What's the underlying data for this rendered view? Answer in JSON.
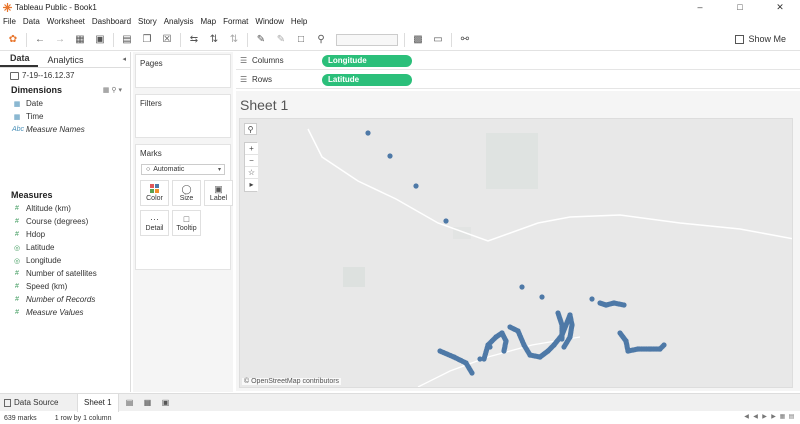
{
  "window": {
    "title": "Tableau Public - Book1",
    "controls": [
      "–",
      "□",
      "✕"
    ]
  },
  "menu": [
    "File",
    "Data",
    "Worksheet",
    "Dashboard",
    "Story",
    "Analysis",
    "Map",
    "Format",
    "Window",
    "Help"
  ],
  "toolbar": {
    "show_me_label": "Show Me"
  },
  "data_pane": {
    "tabs": [
      "Data",
      "Analytics"
    ],
    "collapse": "◂",
    "datasource": "7-19--16.12.37",
    "dimensions_header": "Dimensions",
    "dimensions": [
      {
        "label": "Date",
        "icon": "calendar-icon",
        "italic": false
      },
      {
        "label": "Time",
        "icon": "calendar-icon",
        "italic": false
      },
      {
        "label": "Measure Names",
        "icon": "abc-icon",
        "italic": true
      }
    ],
    "measures_header": "Measures",
    "measures": [
      {
        "label": "Altitude (km)",
        "icon": "measure-icon",
        "italic": false
      },
      {
        "label": "Course (degrees)",
        "icon": "measure-icon",
        "italic": false
      },
      {
        "label": "Hdop",
        "icon": "measure-icon",
        "italic": false
      },
      {
        "label": "Latitude",
        "icon": "globe-icon",
        "italic": false
      },
      {
        "label": "Longitude",
        "icon": "globe-icon",
        "italic": false
      },
      {
        "label": "Number of satellites",
        "icon": "measure-icon",
        "italic": false
      },
      {
        "label": "Speed (km)",
        "icon": "measure-icon",
        "italic": false
      },
      {
        "label": "Number of Records",
        "icon": "measure-icon",
        "italic": true
      },
      {
        "label": "Measure Values",
        "icon": "measure-icon",
        "italic": true
      }
    ]
  },
  "cards": {
    "pages": "Pages",
    "filters": "Filters",
    "marks": "Marks",
    "mark_type": "Automatic",
    "mark_buttons": [
      {
        "label": "Color",
        "icon": "color-icon"
      },
      {
        "label": "Size",
        "icon": "size-icon"
      },
      {
        "label": "Label",
        "icon": "label-icon"
      },
      {
        "label": "Detail",
        "icon": "detail-icon"
      },
      {
        "label": "Tooltip",
        "icon": "tooltip-icon"
      }
    ]
  },
  "shelves": {
    "columns_label": "Columns",
    "columns_pill": "Longitude",
    "rows_label": "Rows",
    "rows_pill": "Latitude",
    "pill_color": "#2bbf7a"
  },
  "view": {
    "sheet_title": "Sheet 1",
    "attribution": "© OpenStreetMap contributors",
    "mark_color": "#4e79a7"
  },
  "tabs": {
    "data_source": "Data Source",
    "sheet": "Sheet 1"
  },
  "status": {
    "marks": "639 marks",
    "rows_cols": "1 row by 1 column"
  }
}
